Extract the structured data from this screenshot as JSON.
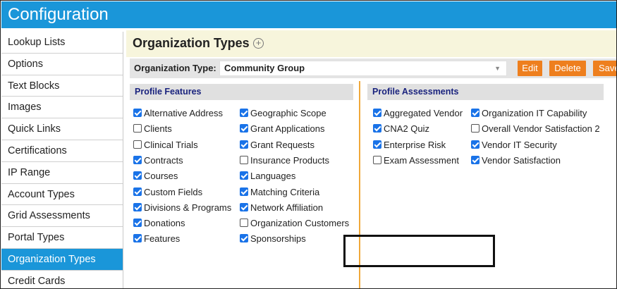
{
  "app_title": "Configuration",
  "sidebar": {
    "items": [
      {
        "label": "Lookup Lists"
      },
      {
        "label": "Options"
      },
      {
        "label": "Text Blocks"
      },
      {
        "label": "Images"
      },
      {
        "label": "Quick Links"
      },
      {
        "label": "Certifications"
      },
      {
        "label": "IP Range"
      },
      {
        "label": "Account Types"
      },
      {
        "label": "Grid Assessments"
      },
      {
        "label": "Portal Types"
      },
      {
        "label": "Organization Types",
        "active": true
      },
      {
        "label": "Credit Cards"
      }
    ]
  },
  "page": {
    "title": "Organization Types",
    "add_icon": "plus-circle-icon",
    "type_label": "Organization Type:",
    "type_value": "Community Group",
    "buttons": {
      "edit": "Edit",
      "delete": "Delete",
      "save": "Save"
    }
  },
  "profile_features": {
    "header": "Profile Features",
    "column1": [
      {
        "label": "Alternative Address",
        "checked": true
      },
      {
        "label": "Clients",
        "checked": false
      },
      {
        "label": "Clinical Trials",
        "checked": false
      },
      {
        "label": "Contracts",
        "checked": true
      },
      {
        "label": "Courses",
        "checked": true
      },
      {
        "label": "Custom Fields",
        "checked": true
      },
      {
        "label": "Divisions & Programs",
        "checked": true
      },
      {
        "label": "Donations",
        "checked": true
      },
      {
        "label": "Features",
        "checked": true
      }
    ],
    "column2": [
      {
        "label": "Geographic Scope",
        "checked": true
      },
      {
        "label": "Grant Applications",
        "checked": true
      },
      {
        "label": "Grant Requests",
        "checked": true
      },
      {
        "label": "Insurance Products",
        "checked": false
      },
      {
        "label": "Languages",
        "checked": true
      },
      {
        "label": "Matching Criteria",
        "checked": true
      },
      {
        "label": "Network Affiliation",
        "checked": true
      },
      {
        "label": "Organization Customers",
        "checked": false
      },
      {
        "label": "Sponsorships",
        "checked": true
      }
    ]
  },
  "profile_assessments": {
    "header": "Profile Assessments",
    "column1": [
      {
        "label": "Aggregated Vendor",
        "checked": true
      },
      {
        "label": "CNA2 Quiz",
        "checked": true
      },
      {
        "label": "Enterprise Risk",
        "checked": true
      },
      {
        "label": "Exam Assessment",
        "checked": false
      }
    ],
    "column2": [
      {
        "label": "Organization IT Capability",
        "checked": true
      },
      {
        "label": "Overall Vendor Satisfaction 2",
        "checked": false
      },
      {
        "label": "Vendor IT Security",
        "checked": true
      },
      {
        "label": "Vendor Satisfaction",
        "checked": true
      }
    ]
  },
  "colors": {
    "accent": "#1a96d9",
    "button": "#ee7f1e",
    "divider": "#f0a83a",
    "header_bg": "#f7f5dc"
  }
}
